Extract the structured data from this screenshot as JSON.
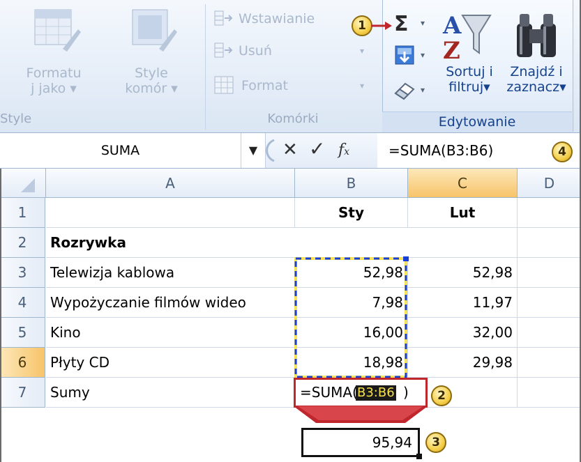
{
  "ribbon": {
    "style_group": {
      "format_as_table": [
        "Formatu",
        "j jako"
      ],
      "cell_styles": [
        "Style",
        "komór"
      ],
      "label": "Style"
    },
    "cells_group": {
      "insert": "Wstawianie",
      "delete": "Usuń",
      "format": "Format",
      "label": "Komórki"
    },
    "editing_group": {
      "sort_filter": [
        "Sortuj i",
        "filtruj"
      ],
      "find_select": [
        "Znajdź i",
        "zaznacz"
      ],
      "label": "Edytowanie"
    }
  },
  "formula_bar": {
    "name_box": "SUMA",
    "formula": "=SUMA(B3:B6)"
  },
  "sheet": {
    "columns": [
      "A",
      "B",
      "C",
      "D"
    ],
    "rows": [
      {
        "num": "1",
        "a": "",
        "b": "Sty",
        "c": "Lut"
      },
      {
        "num": "2",
        "a": "Rozrywka",
        "b": "",
        "c": ""
      },
      {
        "num": "3",
        "a": "Telewizja kablowa",
        "b": "52,98",
        "c": "52,98"
      },
      {
        "num": "4",
        "a": "Wypożyczanie filmów wideo",
        "b": "7,98",
        "c": "11,97"
      },
      {
        "num": "5",
        "a": "Kino",
        "b": "16,00",
        "c": "32,00"
      },
      {
        "num": "6",
        "a": "Płyty CD",
        "b": "18,98",
        "c": "29,98"
      },
      {
        "num": "7",
        "a": "Sumy",
        "b": "",
        "c": ""
      }
    ],
    "editing_formula_prefix": "=SUMA(",
    "editing_formula_ref": "B3:B6",
    "editing_formula_suffix": ")",
    "result_value": "95,94"
  },
  "callouts": [
    "1",
    "2",
    "3",
    "4"
  ],
  "colors": {
    "accent_red": "#c0272d",
    "selection_orange": "#f7c46a",
    "marquee_blue": "#1a3fd6",
    "callout_yellow": "#f4cf4a"
  }
}
